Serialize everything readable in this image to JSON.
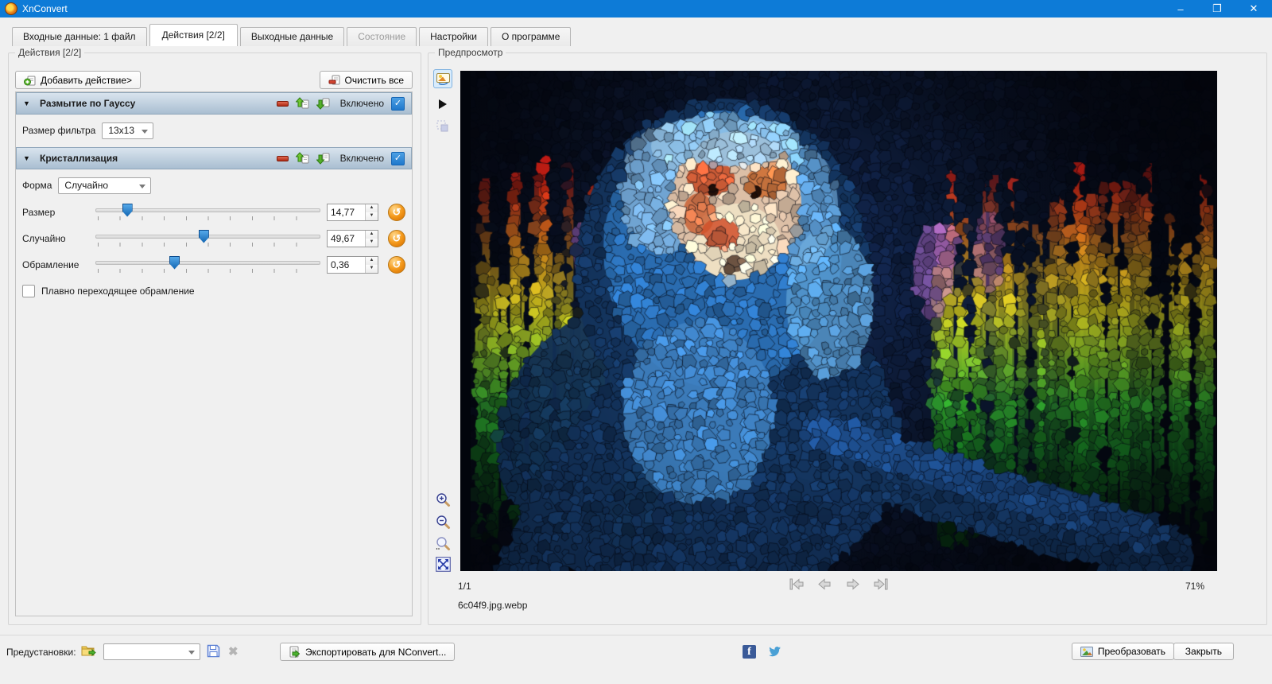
{
  "window": {
    "title": "XnConvert",
    "controls": {
      "minimize": "–",
      "restore": "❐",
      "close": "✕"
    }
  },
  "tabs": [
    {
      "label": "Входные данные: 1 файл",
      "active": false,
      "disabled": false
    },
    {
      "label": "Действия [2/2]",
      "active": true,
      "disabled": false
    },
    {
      "label": "Выходные данные",
      "active": false,
      "disabled": false
    },
    {
      "label": "Состояние",
      "active": false,
      "disabled": true
    },
    {
      "label": "Настройки",
      "active": false,
      "disabled": false
    },
    {
      "label": "О программе",
      "active": false,
      "disabled": false
    }
  ],
  "actions_panel": {
    "legend": "Действия [2/2]",
    "add_button": "Добавить действие>",
    "clear_button": "Очистить все",
    "enabled_label": "Включено",
    "check_glyph": "✓",
    "collapse_glyph": "▼",
    "actions": [
      {
        "title": "Размытие по Гауссу",
        "enabled": true,
        "filter_label": "Размер фильтра",
        "filter_value": "13x13"
      },
      {
        "title": "Кристаллизация",
        "enabled": true,
        "shape_label": "Форма",
        "shape_value": "Случайно",
        "sliders": [
          {
            "label": "Размер",
            "value": "14,77",
            "percent": 14
          },
          {
            "label": "Случайно",
            "value": "49,67",
            "percent": 48
          },
          {
            "label": "Обрамление",
            "value": "0,36",
            "percent": 35
          }
        ],
        "reset_glyph": "↺",
        "checkbox_label": "Плавно переходящее обрамление",
        "checkbox_checked": false
      }
    ]
  },
  "preview_panel": {
    "legend": "Предпросмотр",
    "page_indicator": "1/1",
    "zoom_level": "71%",
    "filename": "6c04f9.jpg.webp",
    "palette": {
      "bg_dark": "#05070f",
      "bg_navy": "#0d1c3c",
      "rainbow": [
        "#a81212",
        "#cc2212",
        "#d4581a",
        "#d99b1c",
        "#d6c91e",
        "#7fbd26",
        "#2f9e28",
        "#156b1d",
        "#0a3a12",
        "#05210b"
      ],
      "monkey_dark": "#14355f",
      "monkey_mid": "#2a6cb0",
      "monkey_light": "#79b4e2",
      "monkey_pale": "#a9d4ee",
      "face_base": "#dcbfa6",
      "face_cream": "#eedfc2",
      "face_red": "#c8502a",
      "face_dark": "#241008",
      "violet": "#9a5fb5",
      "pink": "#b86ab8"
    }
  },
  "footer": {
    "presets_label": "Предустановки:",
    "preset_value": "",
    "export_button": "Экспортировать для NConvert...",
    "facebook_letter": "f",
    "convert_button": "Преобразовать",
    "close_button": "Закрыть"
  }
}
